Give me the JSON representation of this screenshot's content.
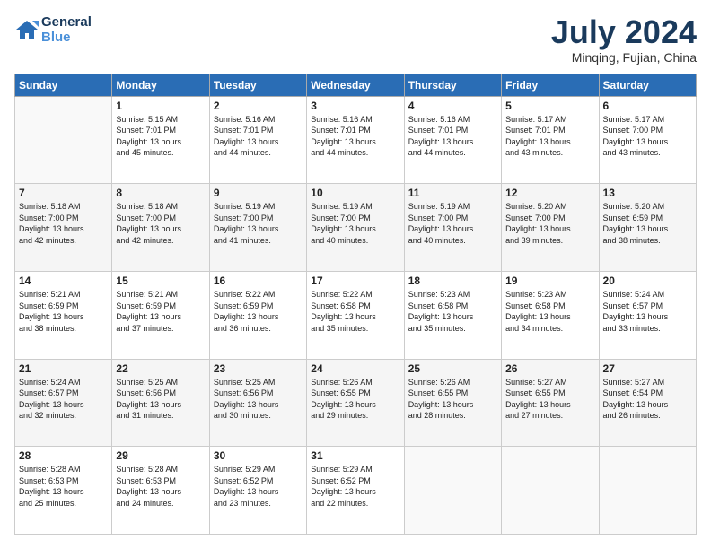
{
  "logo": {
    "line1": "General",
    "line2": "Blue"
  },
  "title": "July 2024",
  "location": "Minqing, Fujian, China",
  "days_of_week": [
    "Sunday",
    "Monday",
    "Tuesday",
    "Wednesday",
    "Thursday",
    "Friday",
    "Saturday"
  ],
  "weeks": [
    {
      "shade": false,
      "days": [
        {
          "num": "",
          "info": ""
        },
        {
          "num": "1",
          "info": "Sunrise: 5:15 AM\nSunset: 7:01 PM\nDaylight: 13 hours\nand 45 minutes."
        },
        {
          "num": "2",
          "info": "Sunrise: 5:16 AM\nSunset: 7:01 PM\nDaylight: 13 hours\nand 44 minutes."
        },
        {
          "num": "3",
          "info": "Sunrise: 5:16 AM\nSunset: 7:01 PM\nDaylight: 13 hours\nand 44 minutes."
        },
        {
          "num": "4",
          "info": "Sunrise: 5:16 AM\nSunset: 7:01 PM\nDaylight: 13 hours\nand 44 minutes."
        },
        {
          "num": "5",
          "info": "Sunrise: 5:17 AM\nSunset: 7:01 PM\nDaylight: 13 hours\nand 43 minutes."
        },
        {
          "num": "6",
          "info": "Sunrise: 5:17 AM\nSunset: 7:00 PM\nDaylight: 13 hours\nand 43 minutes."
        }
      ]
    },
    {
      "shade": true,
      "days": [
        {
          "num": "7",
          "info": "Sunrise: 5:18 AM\nSunset: 7:00 PM\nDaylight: 13 hours\nand 42 minutes."
        },
        {
          "num": "8",
          "info": "Sunrise: 5:18 AM\nSunset: 7:00 PM\nDaylight: 13 hours\nand 42 minutes."
        },
        {
          "num": "9",
          "info": "Sunrise: 5:19 AM\nSunset: 7:00 PM\nDaylight: 13 hours\nand 41 minutes."
        },
        {
          "num": "10",
          "info": "Sunrise: 5:19 AM\nSunset: 7:00 PM\nDaylight: 13 hours\nand 40 minutes."
        },
        {
          "num": "11",
          "info": "Sunrise: 5:19 AM\nSunset: 7:00 PM\nDaylight: 13 hours\nand 40 minutes."
        },
        {
          "num": "12",
          "info": "Sunrise: 5:20 AM\nSunset: 7:00 PM\nDaylight: 13 hours\nand 39 minutes."
        },
        {
          "num": "13",
          "info": "Sunrise: 5:20 AM\nSunset: 6:59 PM\nDaylight: 13 hours\nand 38 minutes."
        }
      ]
    },
    {
      "shade": false,
      "days": [
        {
          "num": "14",
          "info": "Sunrise: 5:21 AM\nSunset: 6:59 PM\nDaylight: 13 hours\nand 38 minutes."
        },
        {
          "num": "15",
          "info": "Sunrise: 5:21 AM\nSunset: 6:59 PM\nDaylight: 13 hours\nand 37 minutes."
        },
        {
          "num": "16",
          "info": "Sunrise: 5:22 AM\nSunset: 6:59 PM\nDaylight: 13 hours\nand 36 minutes."
        },
        {
          "num": "17",
          "info": "Sunrise: 5:22 AM\nSunset: 6:58 PM\nDaylight: 13 hours\nand 35 minutes."
        },
        {
          "num": "18",
          "info": "Sunrise: 5:23 AM\nSunset: 6:58 PM\nDaylight: 13 hours\nand 35 minutes."
        },
        {
          "num": "19",
          "info": "Sunrise: 5:23 AM\nSunset: 6:58 PM\nDaylight: 13 hours\nand 34 minutes."
        },
        {
          "num": "20",
          "info": "Sunrise: 5:24 AM\nSunset: 6:57 PM\nDaylight: 13 hours\nand 33 minutes."
        }
      ]
    },
    {
      "shade": true,
      "days": [
        {
          "num": "21",
          "info": "Sunrise: 5:24 AM\nSunset: 6:57 PM\nDaylight: 13 hours\nand 32 minutes."
        },
        {
          "num": "22",
          "info": "Sunrise: 5:25 AM\nSunset: 6:56 PM\nDaylight: 13 hours\nand 31 minutes."
        },
        {
          "num": "23",
          "info": "Sunrise: 5:25 AM\nSunset: 6:56 PM\nDaylight: 13 hours\nand 30 minutes."
        },
        {
          "num": "24",
          "info": "Sunrise: 5:26 AM\nSunset: 6:55 PM\nDaylight: 13 hours\nand 29 minutes."
        },
        {
          "num": "25",
          "info": "Sunrise: 5:26 AM\nSunset: 6:55 PM\nDaylight: 13 hours\nand 28 minutes."
        },
        {
          "num": "26",
          "info": "Sunrise: 5:27 AM\nSunset: 6:55 PM\nDaylight: 13 hours\nand 27 minutes."
        },
        {
          "num": "27",
          "info": "Sunrise: 5:27 AM\nSunset: 6:54 PM\nDaylight: 13 hours\nand 26 minutes."
        }
      ]
    },
    {
      "shade": false,
      "days": [
        {
          "num": "28",
          "info": "Sunrise: 5:28 AM\nSunset: 6:53 PM\nDaylight: 13 hours\nand 25 minutes."
        },
        {
          "num": "29",
          "info": "Sunrise: 5:28 AM\nSunset: 6:53 PM\nDaylight: 13 hours\nand 24 minutes."
        },
        {
          "num": "30",
          "info": "Sunrise: 5:29 AM\nSunset: 6:52 PM\nDaylight: 13 hours\nand 23 minutes."
        },
        {
          "num": "31",
          "info": "Sunrise: 5:29 AM\nSunset: 6:52 PM\nDaylight: 13 hours\nand 22 minutes."
        },
        {
          "num": "",
          "info": ""
        },
        {
          "num": "",
          "info": ""
        },
        {
          "num": "",
          "info": ""
        }
      ]
    }
  ]
}
